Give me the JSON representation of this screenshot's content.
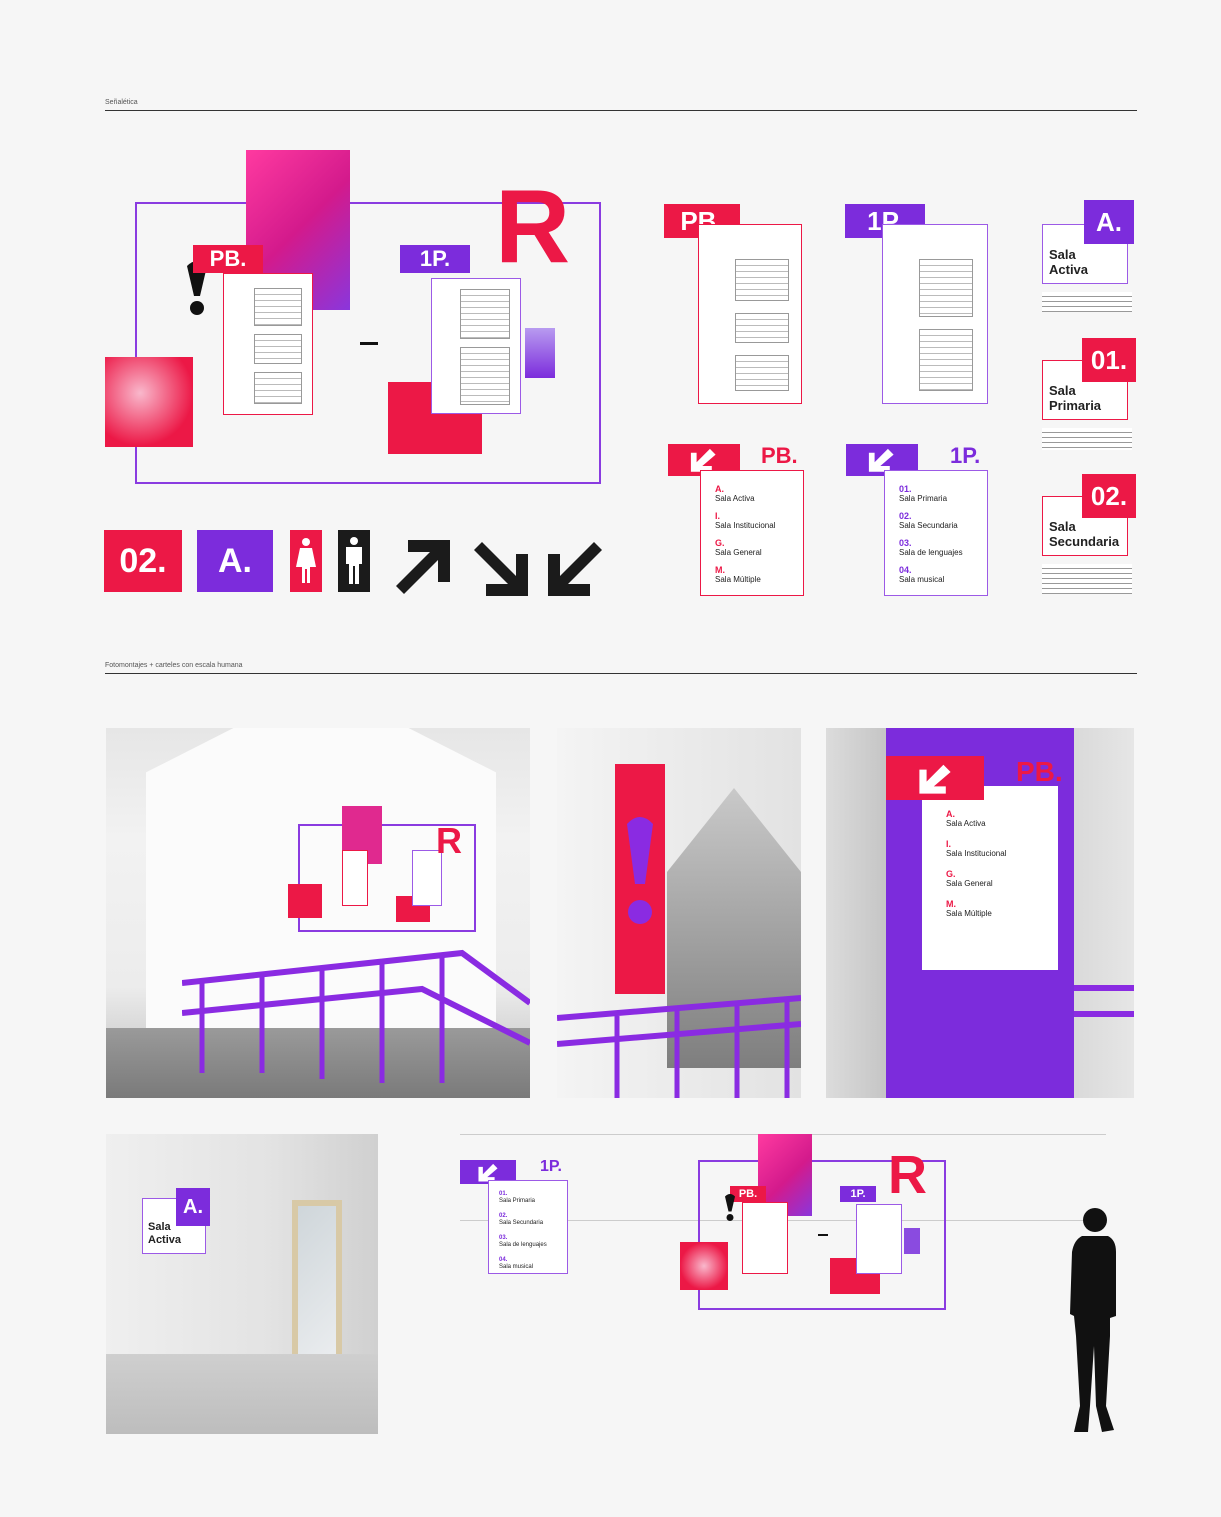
{
  "sections": {
    "signage_label": "Señalética",
    "photomontage_label": "Fotomontajes + carteles con escala humana"
  },
  "floors": {
    "ground": "PB.",
    "first": "1P."
  },
  "big_letter": "R",
  "dash": "-",
  "tags": {
    "two": "02.",
    "a": "A.",
    "one": "01."
  },
  "room_cards": [
    {
      "code": "A.",
      "name": "Sala Activa",
      "color": "purple"
    },
    {
      "code": "01.",
      "name": "Sala Primaria",
      "color": "red"
    },
    {
      "code": "02.",
      "name": "Sala Secundaria",
      "color": "red"
    }
  ],
  "ground_rooms": [
    {
      "code": "A.",
      "name": "Sala Activa"
    },
    {
      "code": "I.",
      "name": "Sala Institucional"
    },
    {
      "code": "G.",
      "name": "Sala General"
    },
    {
      "code": "M.",
      "name": "Sala Múltiple"
    }
  ],
  "first_rooms": [
    {
      "code": "01.",
      "name": "Sala Primaria"
    },
    {
      "code": "02.",
      "name": "Sala Secundaria"
    },
    {
      "code": "03.",
      "name": "Sala de lenguajes"
    },
    {
      "code": "04.",
      "name": "Sala musical"
    }
  ],
  "photo_sign": {
    "ground": "PB.",
    "rooms": [
      {
        "code": "A.",
        "name": "Sala Activa"
      },
      {
        "code": "I.",
        "name": "Sala Institucional"
      },
      {
        "code": "G.",
        "name": "Sala General"
      },
      {
        "code": "M.",
        "name": "Sala Múltiple"
      }
    ]
  },
  "bottom_sign": {
    "floor": "1P.",
    "rooms": [
      {
        "code": "01.",
        "name": "Sala Primaria"
      },
      {
        "code": "02.",
        "name": "Sala Secundaria"
      },
      {
        "code": "03.",
        "name": "Sala de lenguajes"
      },
      {
        "code": "04.",
        "name": "Sala musical"
      }
    ]
  },
  "colors": {
    "red": "#ec1846",
    "purple": "#7c2cdc",
    "black": "#1b1b1b"
  },
  "icons": [
    "exclamation-icon",
    "woman-icon",
    "man-icon",
    "arrow-up-right-icon",
    "arrow-down-right-icon",
    "arrow-down-left-icon",
    "human-silhouette-icon"
  ]
}
